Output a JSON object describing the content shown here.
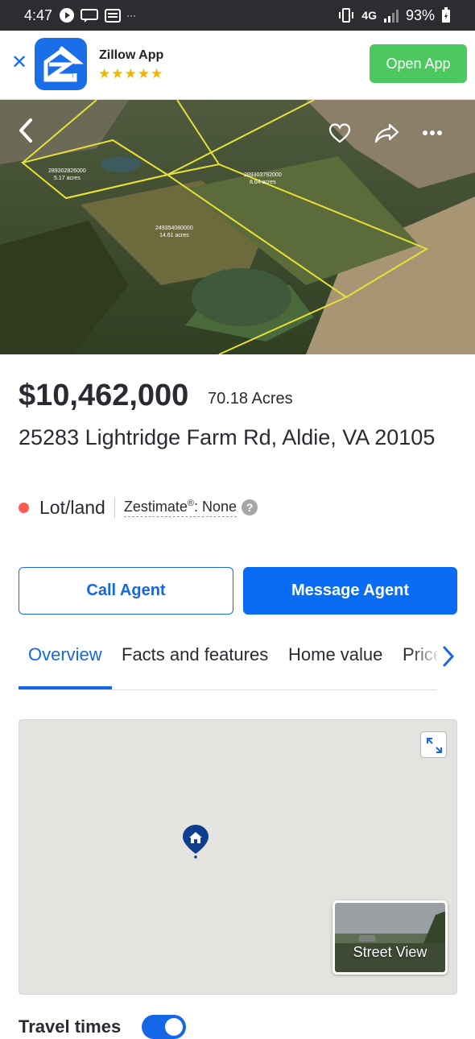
{
  "status_bar": {
    "time": "4:47",
    "ellipsis": "···",
    "network": "4G",
    "battery": "93%"
  },
  "banner": {
    "app_name": "Zillow App",
    "stars": "★★★★★",
    "open_label": "Open App"
  },
  "photo": {
    "parcels": [
      {
        "id": "289302826000",
        "acres": "5.17 acres"
      },
      {
        "id": "289303792000",
        "acres": "8.64 acres"
      },
      {
        "id": "249354080000",
        "acres": "14.61 acres"
      }
    ]
  },
  "listing": {
    "price": "$10,462,000",
    "acres": "70.18 Acres",
    "address": "25283 Lightridge Farm Rd, Aldie, VA 20105",
    "type": "Lot/land",
    "zestimate_label": "Zestimate",
    "zestimate_sup": "®",
    "zestimate_value": ": None",
    "help": "?"
  },
  "actions": {
    "call": "Call Agent",
    "message": "Message Agent"
  },
  "tabs": [
    "Overview",
    "Facts and features",
    "Home value",
    "Price"
  ],
  "map": {
    "street_view": "Street View"
  },
  "section": {
    "travel_times": "Travel times"
  },
  "colors": {
    "accent": "#1567e8",
    "open_app": "#4dc860",
    "status_dot": "#ff5a4f"
  }
}
